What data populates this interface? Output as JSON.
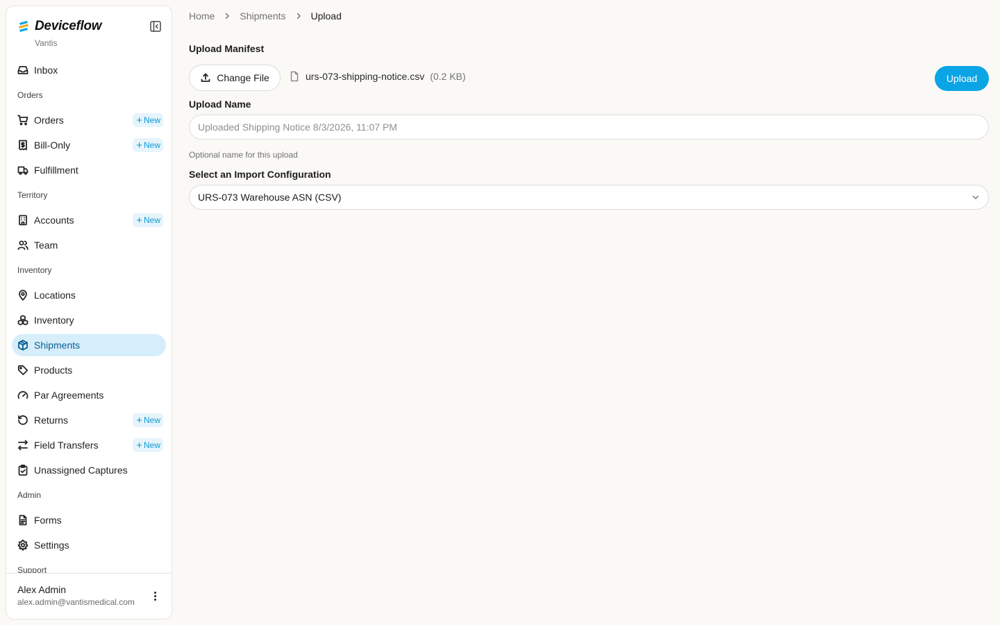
{
  "brand": {
    "name": "Deviceflow",
    "org": "Vantis"
  },
  "sidebar": {
    "new_label": "New",
    "items": [
      {
        "type": "item",
        "label": "Inbox",
        "icon": "inbox-icon"
      },
      {
        "type": "section",
        "label": "Orders"
      },
      {
        "type": "item",
        "label": "Orders",
        "icon": "cart-icon",
        "badge": true
      },
      {
        "type": "item",
        "label": "Bill-Only",
        "icon": "receipt-icon",
        "badge": true
      },
      {
        "type": "item",
        "label": "Fulfillment",
        "icon": "truck-icon"
      },
      {
        "type": "section",
        "label": "Territory"
      },
      {
        "type": "item",
        "label": "Accounts",
        "icon": "building-icon",
        "badge": true
      },
      {
        "type": "item",
        "label": "Team",
        "icon": "users-icon"
      },
      {
        "type": "section",
        "label": "Inventory"
      },
      {
        "type": "item",
        "label": "Locations",
        "icon": "map-pin-icon"
      },
      {
        "type": "item",
        "label": "Inventory",
        "icon": "boxes-icon"
      },
      {
        "type": "item",
        "label": "Shipments",
        "icon": "package-icon",
        "active": true
      },
      {
        "type": "item",
        "label": "Products",
        "icon": "tag-icon"
      },
      {
        "type": "item",
        "label": "Par Agreements",
        "icon": "gauge-icon"
      },
      {
        "type": "item",
        "label": "Returns",
        "icon": "rotate-ccw-icon",
        "badge": true
      },
      {
        "type": "item",
        "label": "Field Transfers",
        "icon": "arrows-left-right-icon",
        "badge": true
      },
      {
        "type": "item",
        "label": "Unassigned Captures",
        "icon": "clipboard-check-icon"
      },
      {
        "type": "section",
        "label": "Admin"
      },
      {
        "type": "item",
        "label": "Forms",
        "icon": "file-text-icon"
      },
      {
        "type": "item",
        "label": "Settings",
        "icon": "gear-icon"
      },
      {
        "type": "section",
        "label": "Support"
      }
    ]
  },
  "user": {
    "name": "Alex Admin",
    "email": "alex.admin@vantismedical.com"
  },
  "breadcrumb": {
    "home": "Home",
    "shipments": "Shipments",
    "current": "Upload"
  },
  "form": {
    "manifest_label": "Upload Manifest",
    "change_file_label": "Change File",
    "file_name": "urs-073-shipping-notice.csv",
    "file_size": "(0.2 KB)",
    "upload_label": "Upload",
    "name_label": "Upload Name",
    "name_placeholder": "Uploaded Shipping Notice 8/3/2026, 11:07 PM",
    "name_value": "",
    "name_hint": "Optional name for this upload",
    "config_label": "Select an Import Configuration",
    "config_value": "URS-073 Warehouse ASN (CSV)"
  },
  "colors": {
    "accent": "#0ba5e6",
    "active_bg": "#d6eefa",
    "active_text": "#0a5f91",
    "background": "#faf9f6"
  }
}
